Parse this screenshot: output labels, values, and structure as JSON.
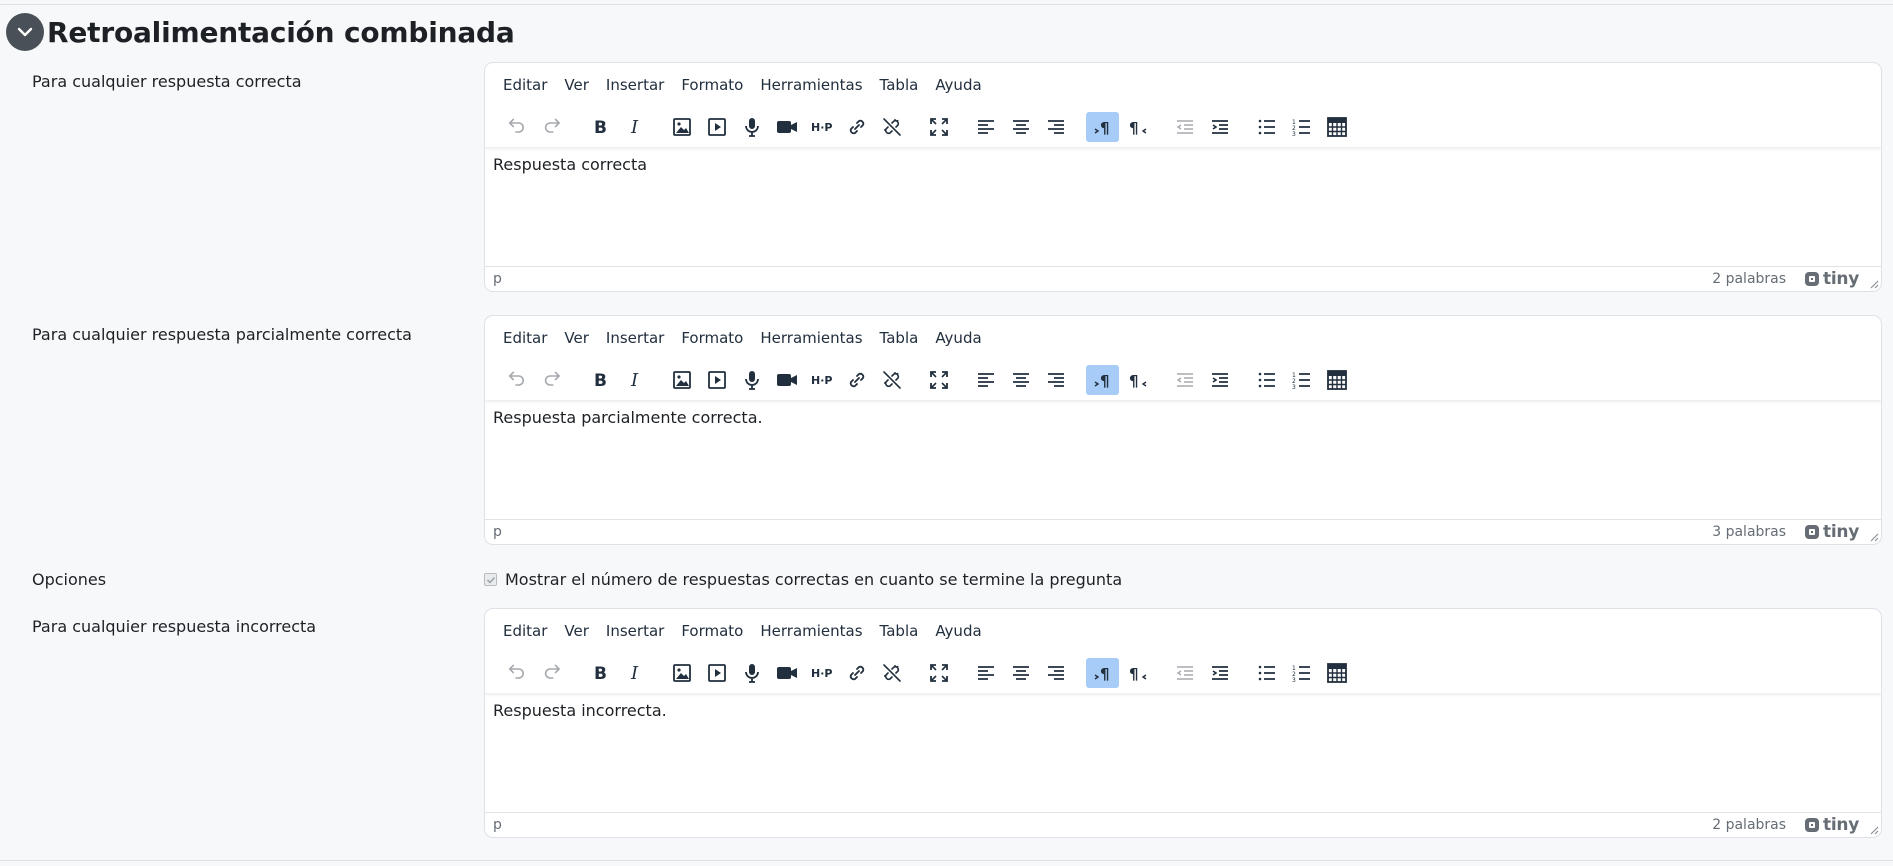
{
  "section": {
    "title": "Retroalimentación combinada"
  },
  "menus": [
    "Editar",
    "Ver",
    "Insertar",
    "Formato",
    "Herramientas",
    "Tabla",
    "Ayuda"
  ],
  "fields": {
    "correct": {
      "label": "Para cualquier respuesta correcta",
      "content": "Respuesta correcta",
      "path": "p",
      "wordcount": "2 palabras"
    },
    "partial": {
      "label": "Para cualquier respuesta parcialmente correcta",
      "content": "Respuesta parcialmente correcta.",
      "path": "p",
      "wordcount": "3 palabras"
    },
    "options": {
      "label": "Opciones",
      "checkbox_label": "Mostrar el número de respuestas correctas en cuanto se termine la pregunta",
      "checked": true,
      "disabled": true
    },
    "incorrect": {
      "label": "Para cualquier respuesta incorrecta",
      "content": "Respuesta incorrecta.",
      "path": "p",
      "wordcount": "2 palabras"
    }
  },
  "toolbar_icons": [
    "undo-icon",
    "redo-icon",
    "bold-icon",
    "italic-icon",
    "image-icon",
    "media-icon",
    "record-audio-icon",
    "record-video-icon",
    "h5p-icon",
    "link-icon",
    "unlink-icon",
    "fullscreen-icon",
    "align-left-icon",
    "align-center-icon",
    "align-right-icon",
    "ltr-icon",
    "rtl-icon",
    "outdent-icon",
    "indent-icon",
    "bullet-list-icon",
    "numbered-list-icon",
    "calculator-icon"
  ],
  "brand": "tiny",
  "colors": {
    "active_button": "#a6ccf7",
    "collapse_button": "#495057",
    "page_background": "#f7f8fa"
  }
}
